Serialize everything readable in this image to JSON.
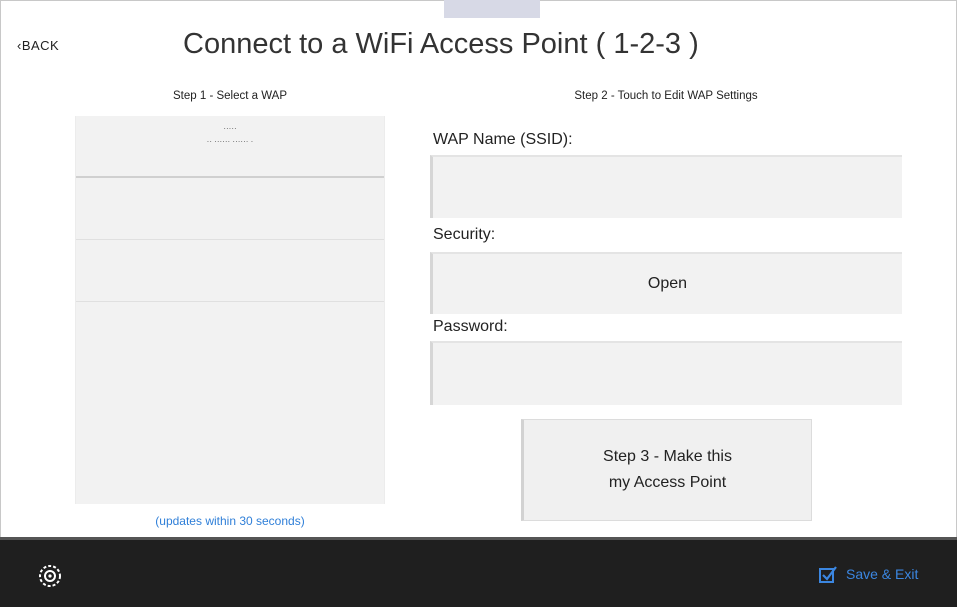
{
  "header": {
    "back_label": "‹BACK",
    "title": "Connect to a WiFi Access Point  ( 1-2-3 )"
  },
  "step1": {
    "label": "Step 1 - Select a WAP",
    "list": [
      {
        "name": "·····",
        "detail": "·· ······ ······ ·"
      },
      {
        "name": "",
        "detail": ""
      },
      {
        "name": "",
        "detail": ""
      }
    ],
    "update_note": "(updates within 30 seconds)"
  },
  "step2": {
    "label": "Step 2 - Touch to Edit WAP Settings",
    "ssid_label": "WAP Name (SSID):",
    "ssid_value": "",
    "security_label": "Security:",
    "security_value": "Open",
    "password_label": "Password:",
    "password_value": ""
  },
  "step3": {
    "line1": "Step 3 - Make this",
    "line2": "my Access Point"
  },
  "footer": {
    "settings_icon": "settings-icon",
    "save_exit_label": "Save & Exit",
    "save_exit_icon": "checkbox-check-icon",
    "accent": "#3b86e0",
    "background": "#1f1f1f"
  }
}
